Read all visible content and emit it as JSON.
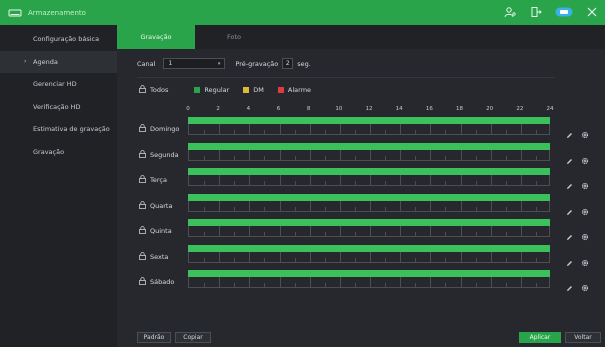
{
  "window": {
    "title": "Armazenamento",
    "icons": [
      "storage-icon",
      "user-icon",
      "logout-icon",
      "toggle-icon",
      "close-icon"
    ]
  },
  "sidebar": {
    "items": [
      {
        "label": "Configuração básica",
        "active": false
      },
      {
        "label": "Agenda",
        "active": true
      },
      {
        "label": "Gerenciar HD",
        "active": false
      },
      {
        "label": "Verificação HD",
        "active": false
      },
      {
        "label": "Estimativa de gravação",
        "active": false
      },
      {
        "label": "Gravação",
        "active": false
      }
    ]
  },
  "tabs": [
    {
      "label": "Gravação",
      "active": true
    },
    {
      "label": "Foto",
      "active": false
    }
  ],
  "controls": {
    "canal_label": "Canal",
    "canal_value": "1",
    "pre_label": "Pré-gravação",
    "pre_value": "2",
    "pre_unit": "seg."
  },
  "legend": {
    "all_label": "Todos",
    "items": [
      {
        "label": "Regular",
        "color": "#2aa44a"
      },
      {
        "label": "DM",
        "color": "#e0b83a"
      },
      {
        "label": "Alarme",
        "color": "#d93d3d"
      }
    ]
  },
  "hours": [
    "0",
    "2",
    "4",
    "6",
    "8",
    "10",
    "12",
    "14",
    "16",
    "18",
    "20",
    "22",
    "24"
  ],
  "days": [
    "Domingo",
    "Segunda",
    "Terça",
    "Quarta",
    "Quinta",
    "Sexta",
    "Sábado"
  ],
  "buttons": {
    "padrao": "Padrão",
    "copiar": "Copiar",
    "aplicar": "Aplicar",
    "voltar": "Voltar"
  },
  "colors": {
    "accent": "#2aa44a",
    "regular_fill": "#3cc05c",
    "background": "#26282d",
    "sidebar": "#202226"
  }
}
